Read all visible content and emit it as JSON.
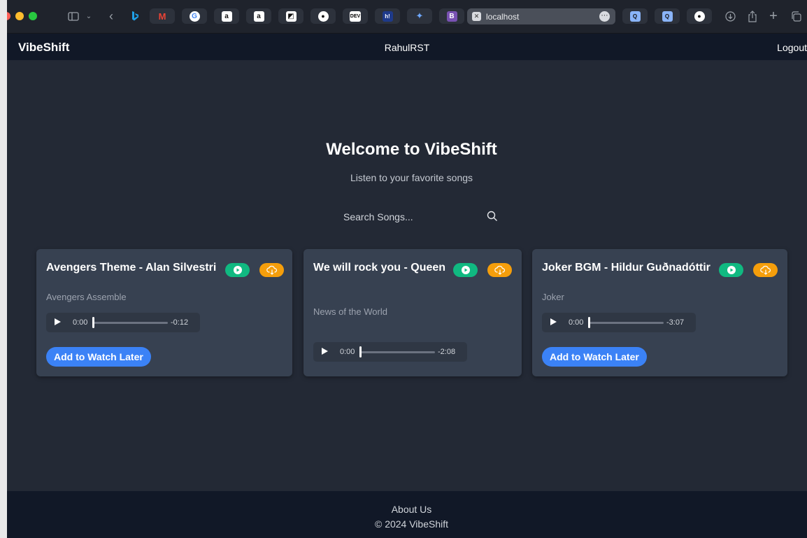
{
  "browser": {
    "address": "localhost",
    "address_icon": "x-box-icon",
    "tabs": [
      {
        "icon": "gmail-icon",
        "glyph": "M",
        "color": "#ea4335",
        "bg": "#2d323c"
      },
      {
        "icon": "google-icon",
        "glyph": "G",
        "color": "#4285f4",
        "bg": "#ffffff"
      },
      {
        "icon": "amazon-icon",
        "glyph": "a",
        "color": "#111111",
        "bg": "#ffffff"
      },
      {
        "icon": "amazon-icon",
        "glyph": "a",
        "color": "#111111",
        "bg": "#ffffff"
      },
      {
        "icon": "dark-square-icon",
        "glyph": "◩",
        "color": "#111111",
        "bg": "#ffffff"
      },
      {
        "icon": "github-icon",
        "glyph": "●",
        "color": "#ffffff",
        "bg": "#2d323c"
      },
      {
        "icon": "dev-icon",
        "glyph": "DEV",
        "color": "#ffffff",
        "bg": "#111111"
      },
      {
        "icon": "hashnode-icon",
        "glyph": "h!",
        "color": "#ffffff",
        "bg": "#2d323c"
      },
      {
        "icon": "gemini-icon",
        "glyph": "✦",
        "color": "#6ea8ff",
        "bg": "#2d323c"
      },
      {
        "icon": "bootstrap-icon",
        "glyph": "B",
        "color": "#ffffff",
        "bg": "#7952b3"
      }
    ],
    "right_tabs": [
      {
        "icon": "search-tab-icon",
        "glyph": "Q",
        "color": "#111111",
        "bg": "#8ab4f8"
      },
      {
        "icon": "search-tab-icon",
        "glyph": "Q",
        "color": "#111111",
        "bg": "#8ab4f8"
      },
      {
        "icon": "github-icon",
        "glyph": "●",
        "color": "#ffffff",
        "bg": "#2d323c"
      }
    ]
  },
  "nav": {
    "brand": "VibeShift",
    "user": "RahulRST",
    "logout": "Logout"
  },
  "hero": {
    "title": "Welcome to VibeShift",
    "subtitle": "Listen to your favorite songs"
  },
  "search": {
    "placeholder": "Search Songs..."
  },
  "songs": [
    {
      "title": "Avengers Theme - Alan Silvestri",
      "album": "Avengers Assemble",
      "current": "0:00",
      "remaining": "-0:12",
      "button": "Add to Watch Later"
    },
    {
      "title": "We will rock you - Queen",
      "album": "News of the World",
      "current": "0:00",
      "remaining": "-2:08",
      "button": ""
    },
    {
      "title": "Joker BGM - Hildur Guðnadóttir",
      "album": "Joker",
      "current": "0:00",
      "remaining": "-3:07",
      "button": "Add to Watch Later"
    }
  ],
  "footer": {
    "about": "About Us",
    "copyright": "© 2024 VibeShift"
  }
}
